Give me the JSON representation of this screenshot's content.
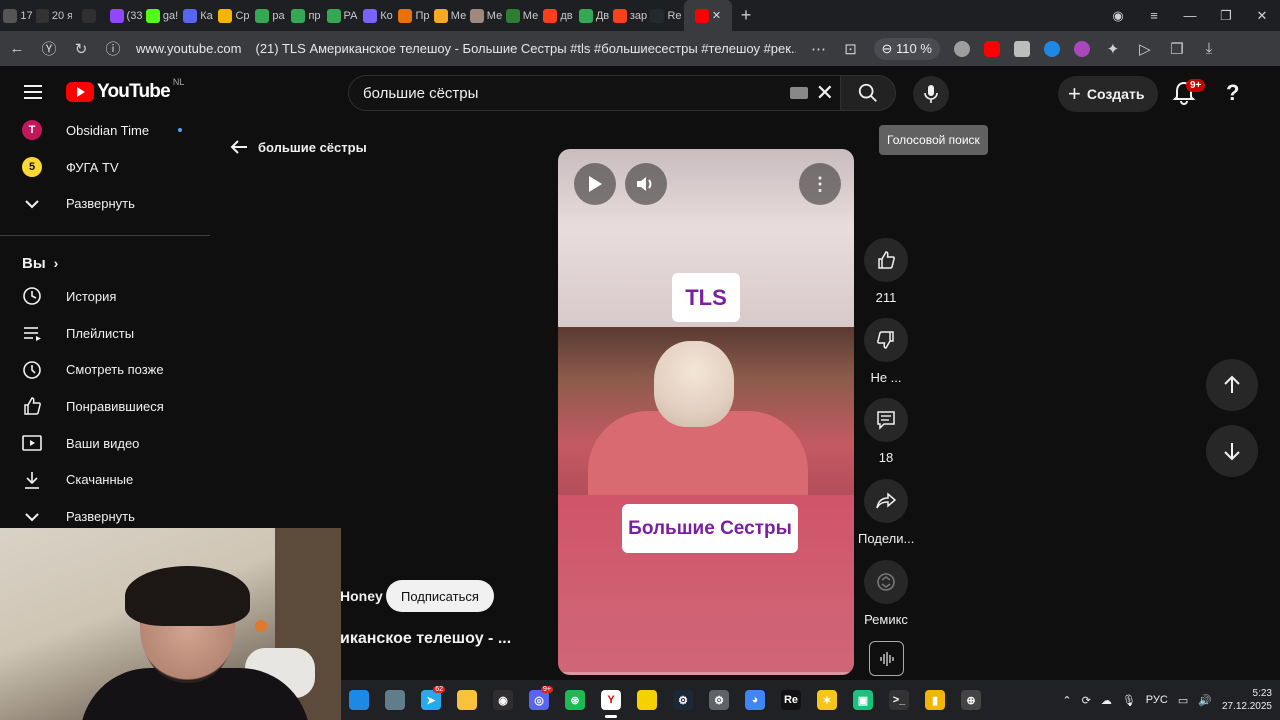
{
  "browser": {
    "tabs": [
      {
        "label": "17",
        "color": "#555555"
      },
      {
        "label": "20 я",
        "color": "#333333"
      },
      {
        "label": "",
        "color": "#303030"
      },
      {
        "label": "(33",
        "color": "#9146ff"
      },
      {
        "label": "ga!",
        "color": "#53fc18"
      },
      {
        "label": "Ка",
        "color": "#5865f2"
      },
      {
        "label": "Ср",
        "color": "#f4b400"
      },
      {
        "label": "ра",
        "color": "#34a853"
      },
      {
        "label": "пр",
        "color": "#34a853"
      },
      {
        "label": "РА",
        "color": "#34a853"
      },
      {
        "label": "Ко",
        "color": "#7b61ff"
      },
      {
        "label": "Пр",
        "color": "#e8710a"
      },
      {
        "label": "Ме",
        "color": "#f9a825"
      },
      {
        "label": "Ме",
        "color": "#a1887f"
      },
      {
        "label": "Ме",
        "color": "#2e7d32"
      },
      {
        "label": "дв",
        "color": "#fc3f1d"
      },
      {
        "label": "Дв",
        "color": "#34a853"
      },
      {
        "label": "зар",
        "color": "#fc3f1d"
      },
      {
        "label": "Re",
        "color": "#24292e"
      }
    ],
    "active_tab_icon_color": "#ff0000",
    "url_domain": "www.youtube.com",
    "page_title": "(21) TLS Американское телешоу - Большие Сестры #tls #большиесестры #телешоу #рек...",
    "zoom": "110 %"
  },
  "header": {
    "logo_text": "YouTube",
    "region": "NL",
    "search_value": "большие сёстры",
    "create_label": "Создать",
    "notif_count": "9+",
    "voice_tooltip": "Голосовой поиск"
  },
  "sidebar": {
    "subscriptions": [
      {
        "label": "Obsidian Time",
        "avatar": "T",
        "color": "#c2185b"
      },
      {
        "label": "ФУГА TV",
        "avatar": "5",
        "color": "#fdd835"
      }
    ],
    "expand_label_1": "Развернуть",
    "you_label": "Вы",
    "you_items": [
      {
        "label": "История",
        "icon": "history-icon"
      },
      {
        "label": "Плейлисты",
        "icon": "playlists-icon"
      },
      {
        "label": "Смотреть позже",
        "icon": "watch-later-icon"
      },
      {
        "label": "Понравившиеся",
        "icon": "liked-icon"
      },
      {
        "label": "Ваши видео",
        "icon": "your-videos-icon"
      },
      {
        "label": "Скачанные",
        "icon": "downloads-icon"
      }
    ],
    "expand_label_2": "Развернуть"
  },
  "shorts": {
    "back_label": "большие сёстры",
    "overlay_top": "TLS",
    "overlay_bottom": "Большие Сестры",
    "likes": "211",
    "dislike_label": "Не ...",
    "comments": "18",
    "share_label": "Подели...",
    "remix_label": "Ремикс",
    "channel_name": "Honey",
    "subscribe_label": "Подписаться",
    "title": "иканское телешоу - ..."
  },
  "taskbar": {
    "apps": [
      {
        "name": "taskbar-app-1",
        "color": "#1e88e5",
        "glyph": ""
      },
      {
        "name": "taskbar-app-2",
        "color": "#607d8b",
        "glyph": ""
      },
      {
        "name": "telegram-app",
        "color": "#29a9eb",
        "glyph": "➤",
        "badge": "62"
      },
      {
        "name": "explorer-app",
        "color": "#f9c23c",
        "glyph": ""
      },
      {
        "name": "obs-app",
        "color": "#302e31",
        "glyph": "◉"
      },
      {
        "name": "discord-app",
        "color": "#5865f2",
        "glyph": "◎",
        "badge": "9+"
      },
      {
        "name": "xbox-app",
        "color": "#1db954",
        "glyph": "⊛"
      },
      {
        "name": "yandex-browser-app",
        "color": "#ffffff",
        "glyph": "Y",
        "active": true
      },
      {
        "name": "notes-app",
        "color": "#f7d000",
        "glyph": ""
      },
      {
        "name": "steam-app",
        "color": "#1b2838",
        "glyph": "⚙"
      },
      {
        "name": "settings-app",
        "color": "#5f6368",
        "glyph": "⚙"
      },
      {
        "name": "chrome-app",
        "color": "#4285f4",
        "glyph": "◕"
      },
      {
        "name": "re-app",
        "color": "#111111",
        "glyph": "Re"
      },
      {
        "name": "sparkle-app",
        "color": "#f5c518",
        "glyph": "✶"
      },
      {
        "name": "green-app",
        "color": "#19c37d",
        "glyph": "▣"
      },
      {
        "name": "terminal-app",
        "color": "#333333",
        "glyph": ">_"
      },
      {
        "name": "yellow-app",
        "color": "#f2b705",
        "glyph": "▮"
      },
      {
        "name": "globe-app",
        "color": "#444444",
        "glyph": "⊕"
      }
    ],
    "lang": "РУС",
    "time": "5:23",
    "date": "27.12.2025"
  }
}
